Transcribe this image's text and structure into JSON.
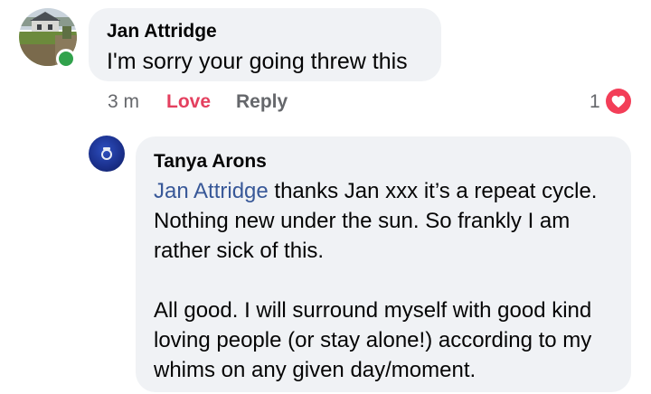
{
  "comment": {
    "author": "Jan Attridge",
    "text": "I'm sorry your going threw this",
    "actions": {
      "time": "3 m",
      "love": "Love",
      "reply": "Reply"
    },
    "reaction_count": "1",
    "reaction_icon": "heart-icon",
    "online": true
  },
  "reply_comment": {
    "author": "Tanya Arons",
    "mention": "Jan Attridge",
    "text_after_mention": " thanks Jan xxx it’s a repeat cycle.  Nothing new under the sun.  So frankly I am rather sick of this.",
    "paragraph2": "All good.  I will surround myself with good kind loving people (or stay alone!) according to my whims on any given day/moment."
  },
  "colors": {
    "bubble": "#f0f2f5",
    "love": "#e4405f",
    "mention": "#385898",
    "online": "#31a24c",
    "muted": "#65676b"
  }
}
